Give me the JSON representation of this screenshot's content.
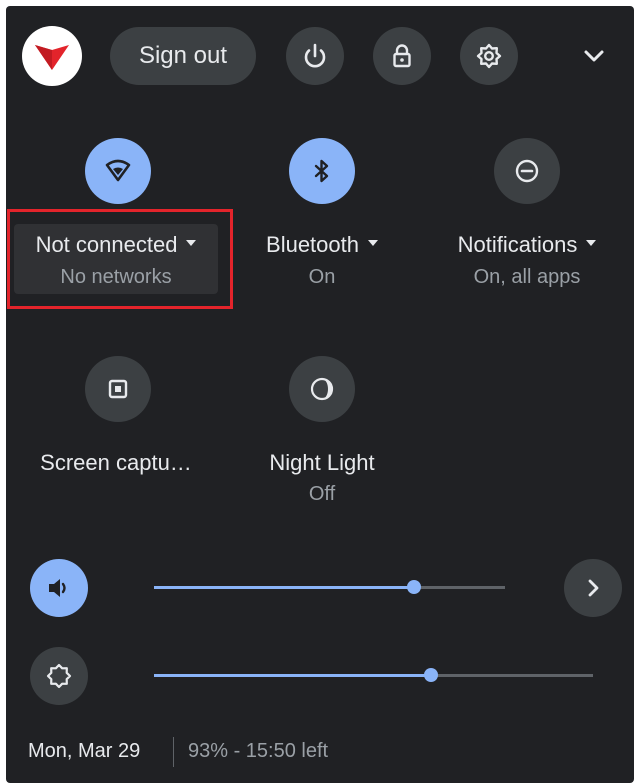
{
  "header": {
    "avatar_icon": "account-avatar-logo",
    "signout_label": "Sign out",
    "power_icon": "power-icon",
    "lock_icon": "lock-icon",
    "settings_icon": "gear-icon",
    "collapse_icon": "chevron-down-icon"
  },
  "tiles": {
    "network": {
      "icon": "wifi-icon",
      "label": "Not connected",
      "sublabel": "No networks",
      "state": "on"
    },
    "bluetooth": {
      "icon": "bluetooth-icon",
      "label": "Bluetooth",
      "sublabel": "On",
      "state": "on"
    },
    "notifications": {
      "icon": "do-not-disturb-icon",
      "label": "Notifications",
      "sublabel": "On, all apps",
      "state": "off"
    },
    "screen_capture": {
      "icon": "screen-capture-icon",
      "label": "Screen captu…",
      "state": "off"
    },
    "night_light": {
      "icon": "night-light-icon",
      "label": "Night Light",
      "sublabel": "Off",
      "state": "off"
    }
  },
  "sliders": {
    "volume": {
      "icon": "volume-icon",
      "level": 0.74,
      "details_icon": "chevron-right-icon"
    },
    "brightness": {
      "icon": "brightness-icon",
      "level": 0.63
    }
  },
  "footer": {
    "date": "Mon, Mar 29",
    "battery": "93% - 15:50 left"
  },
  "colors": {
    "panel_background": "#202124",
    "button_background": "#3c4043",
    "accent": "#8ab4f8",
    "highlight_box": "#e3242b",
    "primary_text": "#e8eaed",
    "secondary_text": "#9aa0a6"
  }
}
